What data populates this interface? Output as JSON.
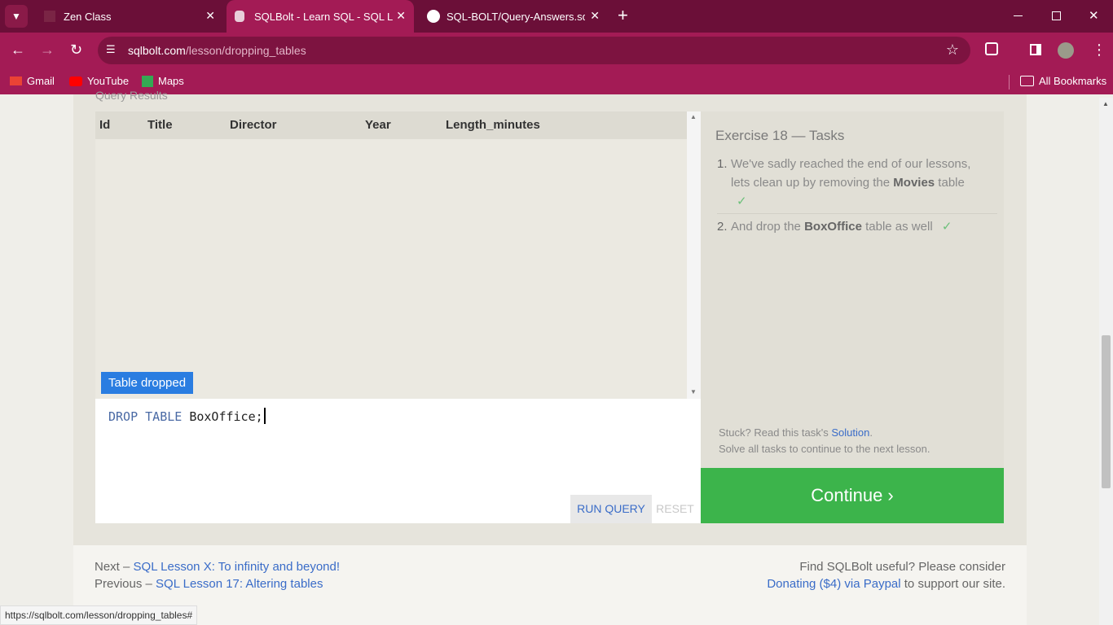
{
  "browser": {
    "tabs": [
      {
        "title": "Zen Class"
      },
      {
        "title": "SQLBolt - Learn SQL - SQL Lesson"
      },
      {
        "title": "SQL-BOLT/Query-Answers.sql at"
      }
    ],
    "close_glyph": "✕",
    "new_tab_glyph": "+",
    "url_host": "sqlbolt.com",
    "url_path": "/lesson/dropping_tables",
    "bookmarks": [
      "Gmail",
      "YouTube",
      "Maps"
    ],
    "all_bookmarks": "All Bookmarks"
  },
  "results": {
    "partial_label": "Query Results",
    "columns": [
      "Id",
      "Title",
      "Director",
      "Year",
      "Length_minutes"
    ],
    "badge": "Table dropped"
  },
  "editor": {
    "kw1": "DROP",
    "kw2": "TABLE",
    "rest": " BoxOffice;",
    "run_label": "RUN QUERY",
    "reset_label": "RESET"
  },
  "tasks": {
    "title": "Exercise 18 — Tasks",
    "items": [
      {
        "num": "1.",
        "pre": "We've sadly reached the end of our lessons, lets clean up by removing the ",
        "bold": "Movies",
        "post": " table",
        "check": "✓"
      },
      {
        "num": "2.",
        "pre": "And drop the ",
        "bold": "BoxOffice",
        "post": " table as well",
        "check": "✓"
      }
    ],
    "stuck_pre": "Stuck? Read this task's ",
    "solution_link": "Solution",
    "stuck_post": ".",
    "solve_all": "Solve all tasks to continue to the next lesson.",
    "continue_label": "Continue ›"
  },
  "footer": {
    "next_prefix": "Next – ",
    "next_link": "SQL Lesson X: To infinity and beyond!",
    "prev_prefix": "Previous – ",
    "prev_link": "SQL Lesson 17: Altering tables",
    "useful": "Find SQLBolt useful? Please consider",
    "donate_link": "Donating ($4) via Paypal",
    "donate_suffix": " to support our site."
  },
  "status_url": "https://sqlbolt.com/lesson/dropping_tables#",
  "colors": {
    "brand": "#a31b55",
    "accent": "#3a6cc8",
    "success": "#3cb44b"
  }
}
